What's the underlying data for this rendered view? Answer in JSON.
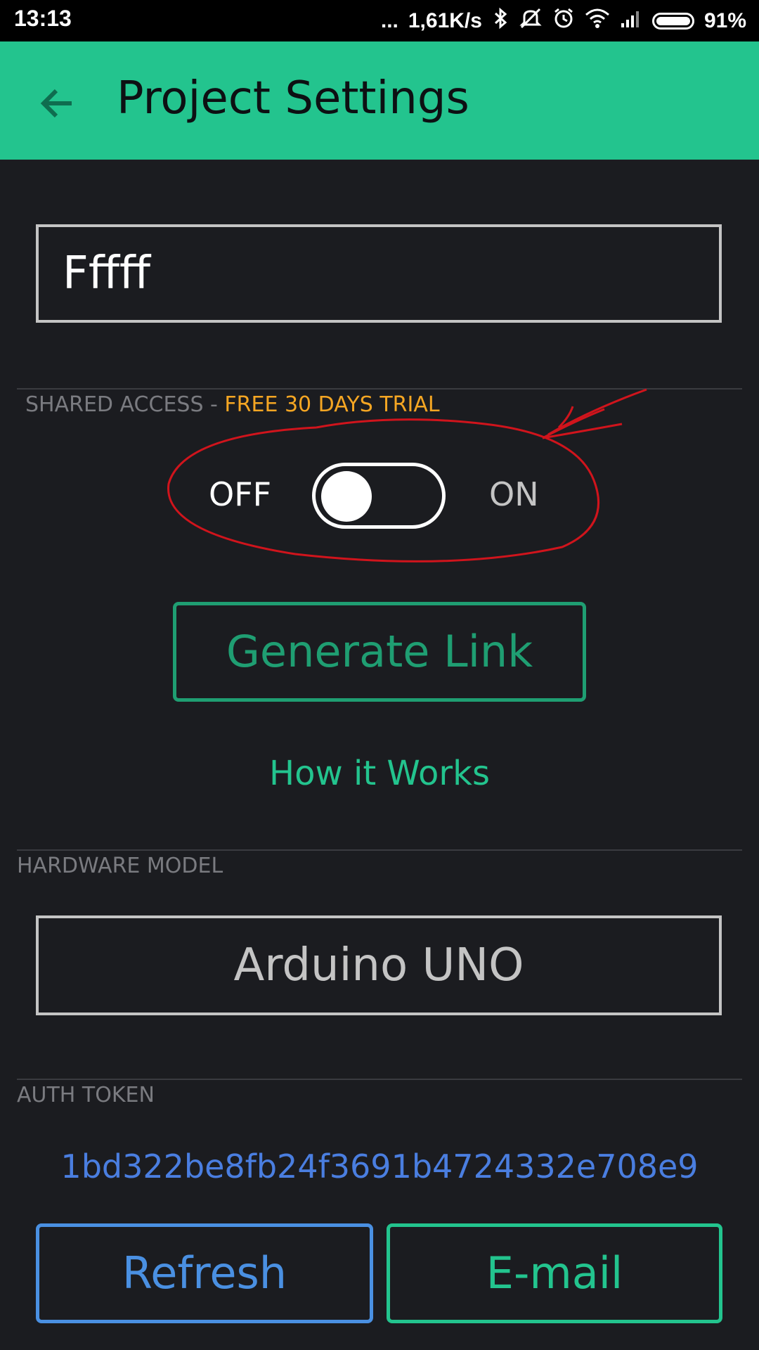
{
  "status_bar": {
    "time": "13:13",
    "dots": "...",
    "speed": "1,61K/s",
    "battery_percent": "91%",
    "icons": [
      "bluetooth-icon",
      "mute-icon",
      "alarm-icon",
      "wifi-icon",
      "signal-icon",
      "battery-icon"
    ]
  },
  "app_bar": {
    "title": "Project Settings",
    "back_icon": "arrow-left-icon",
    "color": "#23c48e"
  },
  "project_name": {
    "value": "Fffff"
  },
  "shared_access": {
    "label": "SHARED ACCESS - ",
    "trial": "FREE 30 DAYS TRIAL",
    "off_label": "OFF",
    "on_label": "ON",
    "toggle_state": "off",
    "generate_link_label": "Generate Link",
    "how_it_works_label": "How it Works"
  },
  "hardware_model": {
    "label": "HARDWARE MODEL",
    "value": "Arduino UNO"
  },
  "auth_token": {
    "label": "AUTH TOKEN",
    "value": "1bd322be8fb24f3691b4724332e708e9",
    "refresh_label": "Refresh",
    "email_label": "E-mail"
  },
  "colors": {
    "background": "#1b1c20",
    "accent_green": "#23c48e",
    "blue": "#4a90e2",
    "trial_orange": "#f5a623",
    "annotation_red": "#d0141c"
  }
}
